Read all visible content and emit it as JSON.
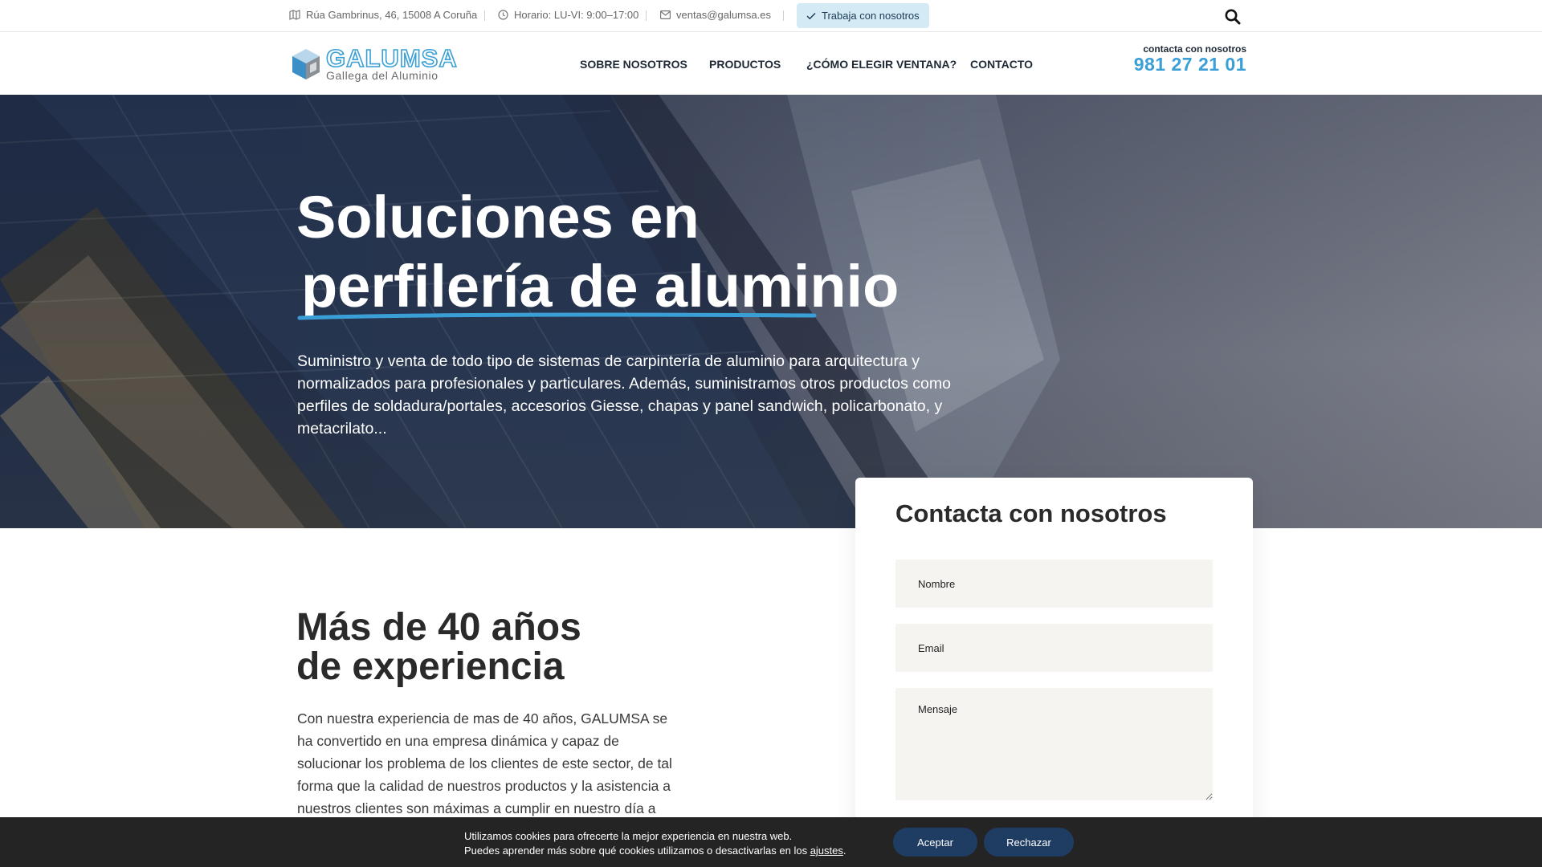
{
  "topbar": {
    "address": "Rúa Gambrinus, 46, 15008 A Coruña",
    "hours": "Horario: LU-VI: 9:00–17:00",
    "email": "ventas@galumsa.es",
    "work_button": "Trabaja con nosotros",
    "icons": [
      "map-icon",
      "clock-icon",
      "envelope-icon",
      "check-icon",
      "search-icon"
    ]
  },
  "header": {
    "logo_main": "GALUMSA",
    "logo_sub": "Gallega del Aluminio",
    "nav": [
      "SOBRE NOSOTROS",
      "PRODUCTOS",
      "¿CÓMO ELEGIR VENTANA?",
      "CONTACTO"
    ],
    "phone_label": "contacta con nosotros",
    "phone_number": "981 27 21 01"
  },
  "hero": {
    "title_line1": "Soluciones en",
    "title_line2": "perfilería de aluminio",
    "description": "Suministro y venta de todo tipo de sistemas de carpintería de aluminio para arquitectura y normalizados para profesionales y particulares. Además, suministramos otros productos como perfiles de soldadura/portales, accesorios Giesse, chapas y panel sandwich, policarbonato, y metacrilato..."
  },
  "contact_form": {
    "title": "Contacta con nosotros",
    "name_placeholder": "Nombre",
    "email_placeholder": "Email",
    "message_placeholder": "Mensaje"
  },
  "about": {
    "title_line1": "Más de 40 años",
    "title_line2": "de experiencia",
    "text": "Con nuestra experiencia de mas de 40 años, GALUMSA se ha convertido en una empresa dinámica y capaz de solucionar los problema de los clientes de este sector, de tal forma que la calidad de nuestros productos y la asistencia a nuestros clientes son máximas a cumplir en nuestro día a día."
  },
  "cookies": {
    "line1": "Utilizamos cookies para ofrecerte la mejor experiencia en nuestra web.",
    "line2_prefix": "Puedes aprender más sobre qué cookies utilizamos o desactivarlas en los ",
    "line2_link": "ajustes",
    "line2_suffix": ".",
    "accept": "Aceptar",
    "reject": "Rechazar"
  },
  "colors": {
    "accent": "#3a9fd6",
    "dark_text": "#1f2a36",
    "button_dark": "#1f3c63",
    "work_button_bg": "#d4ebf6",
    "cookie_bg": "#242424"
  }
}
